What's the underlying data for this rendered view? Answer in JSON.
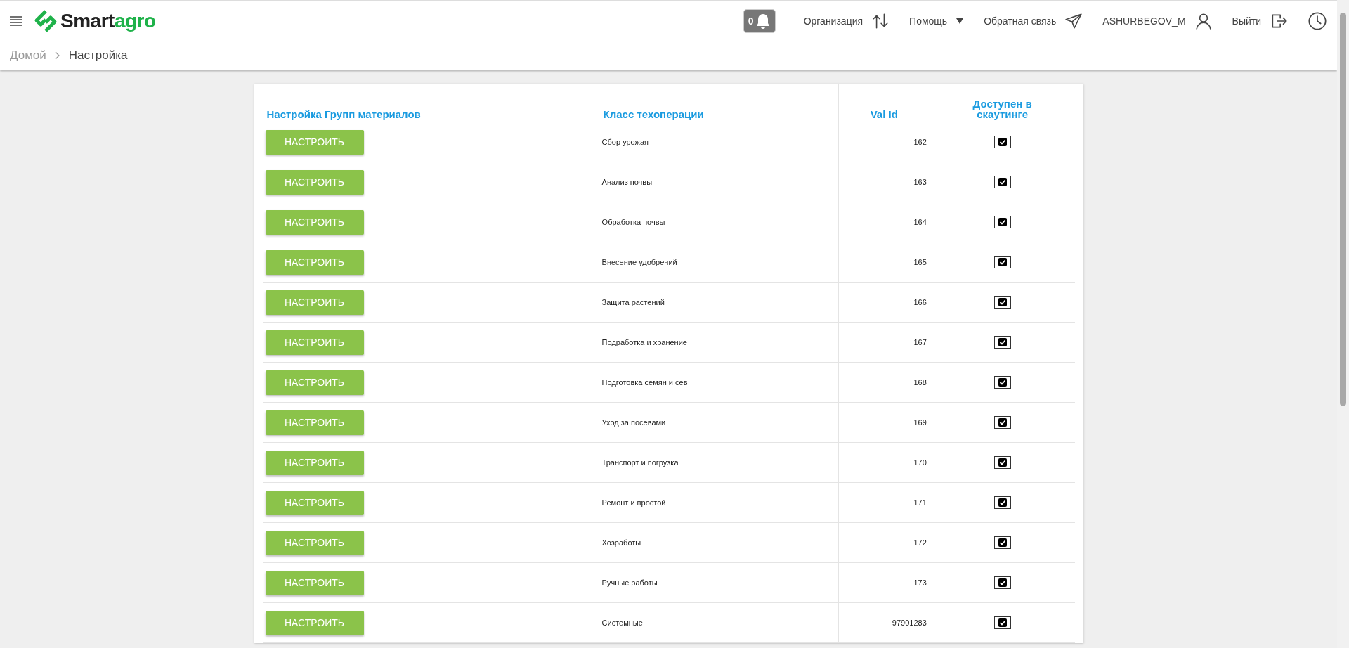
{
  "header": {
    "logo": {
      "dark": "Smart",
      "green": "agro"
    },
    "notifications": "0",
    "menu": [
      {
        "label": "Организация"
      },
      {
        "label": "Помощь"
      },
      {
        "label": "Обратная связь"
      },
      {
        "label": "ASHURBEGOV_M"
      },
      {
        "label": "Выйти"
      }
    ]
  },
  "breadcrumb": [
    "Домой",
    "Настройка"
  ],
  "table": {
    "columns": [
      "Настройка Групп материалов",
      "Класс техоперации",
      "Val Id",
      "Доступен в скаутинге"
    ],
    "rows": [
      {
        "button": "НАСТРОИТЬ",
        "class": "Сбор урожая",
        "val_id": "162",
        "available": true
      },
      {
        "button": "НАСТРОИТЬ",
        "class": "Анализ почвы",
        "val_id": "163",
        "available": true
      },
      {
        "button": "НАСТРОИТЬ",
        "class": "Обработка почвы",
        "val_id": "164",
        "available": true
      },
      {
        "button": "НАСТРОИТЬ",
        "class": "Внесение удобрений",
        "val_id": "165",
        "available": true
      },
      {
        "button": "НАСТРОИТЬ",
        "class": "Защита растений",
        "val_id": "166",
        "available": true
      },
      {
        "button": "НАСТРОИТЬ",
        "class": "Подработка и хранение",
        "val_id": "167",
        "available": true
      },
      {
        "button": "НАСТРОИТЬ",
        "class": "Подготовка семян и сев",
        "val_id": "168",
        "available": true
      },
      {
        "button": "НАСТРОИТЬ",
        "class": "Уход за посевами",
        "val_id": "169",
        "available": true
      },
      {
        "button": "НАСТРОИТЬ",
        "class": "Транспорт и погрузка",
        "val_id": "170",
        "available": true
      },
      {
        "button": "НАСТРОИТЬ",
        "class": "Ремонт и простой",
        "val_id": "171",
        "available": true
      },
      {
        "button": "НАСТРОИТЬ",
        "class": "Хозработы",
        "val_id": "172",
        "available": true
      },
      {
        "button": "НАСТРОИТЬ",
        "class": "Ручные работы",
        "val_id": "173",
        "available": true
      },
      {
        "button": "НАСТРОИТЬ",
        "class": "Системные",
        "val_id": "97901283",
        "available": true
      }
    ]
  }
}
